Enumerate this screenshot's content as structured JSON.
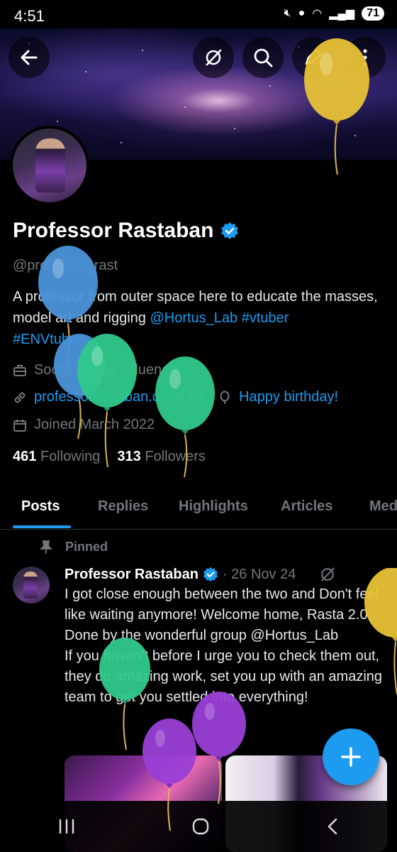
{
  "status_bar": {
    "time": "4:51",
    "battery": "71"
  },
  "profile": {
    "display_name": "Professor Rastaban",
    "handle": "@professor_rast",
    "bio_text": "A professor from outer space here to educate the masses, model art and rigging ",
    "bio_mention": "@Hortus_Lab",
    "bio_tag1": "#vtuber",
    "bio_tag2": "#ENVtuber",
    "category": "Social Media Influencer",
    "website": "professorrastaban.carrd.co",
    "birthday": "Happy birthday!",
    "joined": "Joined March 2022",
    "following_count": "461",
    "following_label": "Following",
    "followers_count": "313",
    "followers_label": "Followers"
  },
  "tabs": [
    {
      "label": "Posts"
    },
    {
      "label": "Replies"
    },
    {
      "label": "Highlights"
    },
    {
      "label": "Articles"
    },
    {
      "label": "Med"
    }
  ],
  "pinned_label": "Pinned",
  "post": {
    "author": "Professor Rastaban",
    "date": "· 26 Nov 24",
    "text": "I got close enough between the two and Don't feel like waiting anymore! Welcome home, Rasta 2.0 Done by the wonderful group @Hortus_Lab\nIf you haven't before I urge you to check them out, they do amazing work, set you up with an amazing team to get you settled into everything!"
  },
  "colors": {
    "accent": "#1d9bf0",
    "muted": "#71767b",
    "background": "#000000"
  },
  "icons": [
    "back-arrow-icon",
    "grok-icon",
    "search-icon",
    "edit-icon",
    "more-icon",
    "verified-icon",
    "briefcase-icon",
    "link-icon",
    "balloon-icon",
    "calendar-icon",
    "pin-icon",
    "compose-icon"
  ]
}
